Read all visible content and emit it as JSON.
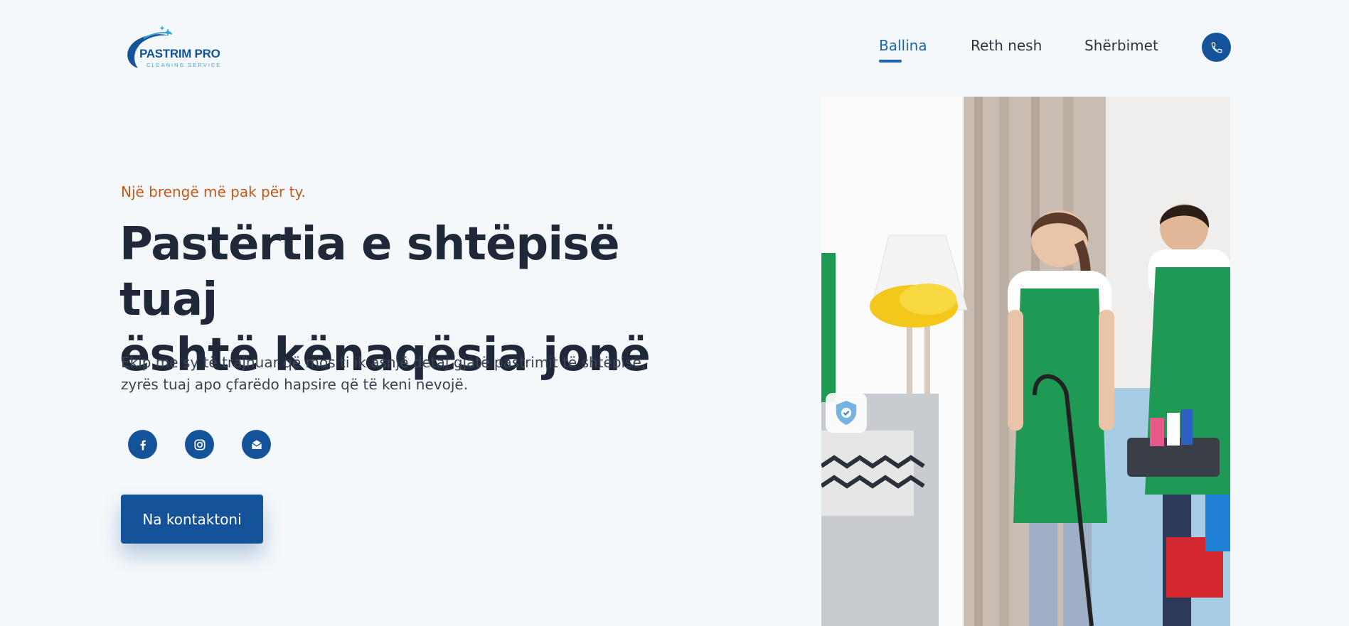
{
  "header": {
    "logo": {
      "title": "PASTRIM PRO",
      "subtitle": "CLEANING SERVICE"
    },
    "nav": [
      {
        "label": "Ballina",
        "active": true
      },
      {
        "label": "Reth nesh",
        "active": false
      },
      {
        "label": "Shërbimet",
        "active": false
      }
    ],
    "phone_icon": "phone-icon"
  },
  "hero": {
    "tagline": "Një brengë më pak për ty.",
    "headline_line1": "Pastërtia e shtëpisë tuaj",
    "headline_line2": "është kënaqësia jonë",
    "description": "Ekip me sy të trajnuar që mos ti ik asnjë detaj gjatë pastrimit të shtëpisë, zyrës tuaj apo çfarëdo hapsire që të keni nevojë.",
    "social": [
      "facebook-icon",
      "instagram-icon",
      "email-icon"
    ],
    "cta_label": "Na kontaktoni"
  },
  "colors": {
    "background": "#f4f8fa",
    "primary": "#14539a",
    "accent_orange": "#c65a1a",
    "text_dark": "#1f2838"
  }
}
